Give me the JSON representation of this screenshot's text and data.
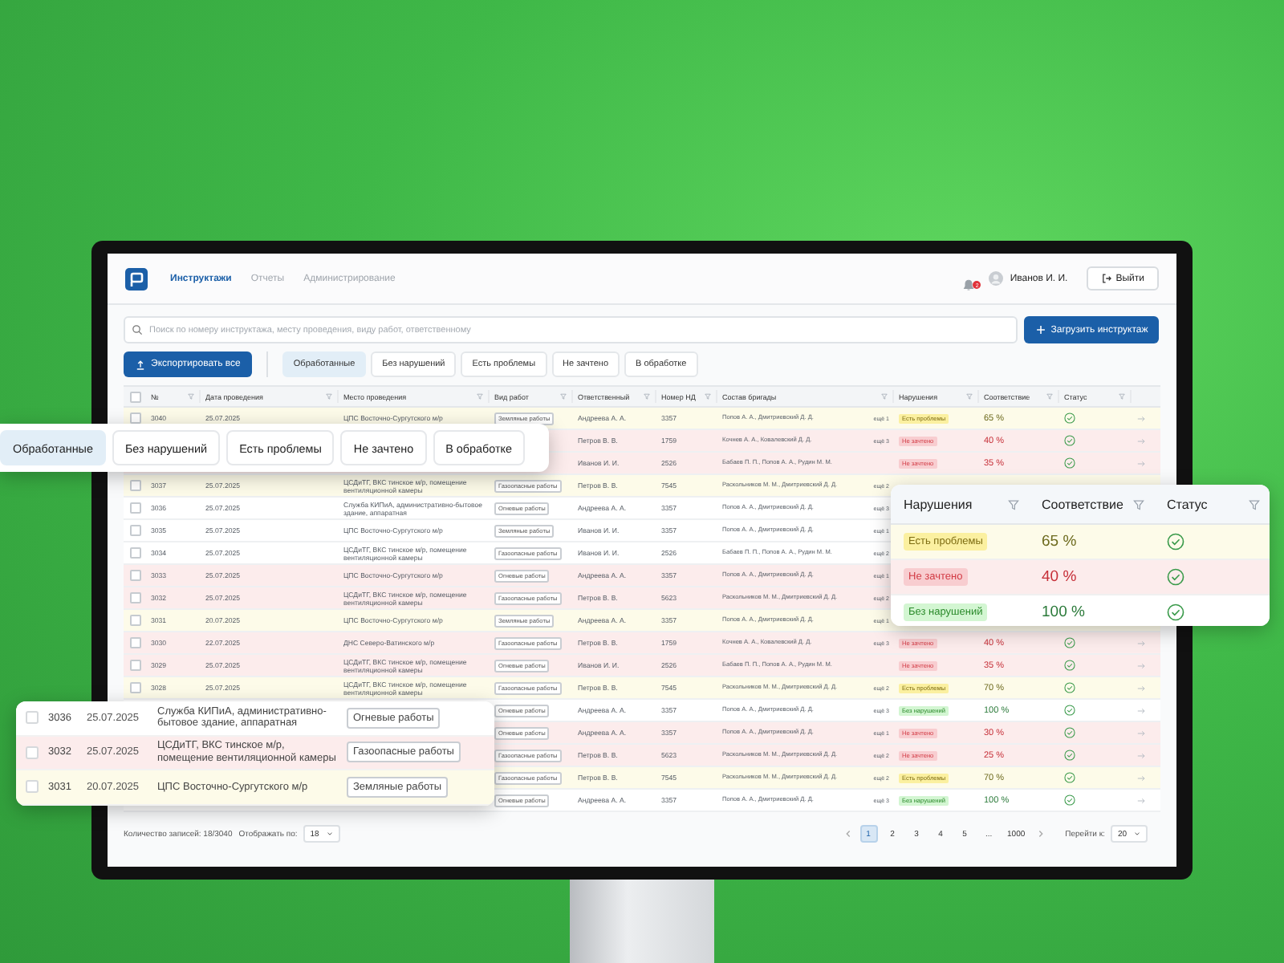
{
  "header": {
    "nav": [
      {
        "label": "Инструктажи",
        "selected": true
      },
      {
        "label": "Отчеты",
        "selected": false
      },
      {
        "label": "Администрирование",
        "selected": false
      }
    ],
    "notifications": "2",
    "user": "Иванов И. И.",
    "logout": "Выйти"
  },
  "search": {
    "placeholder": "Поиск по номеру инструктажа, месту проведения, виду работ, ответственному"
  },
  "upload_button": "Загрузить инструктаж",
  "export_button": "Экспортировать все",
  "filters": [
    {
      "label": "Обработанные",
      "selected": true
    },
    {
      "label": "Без нарушений",
      "selected": false
    },
    {
      "label": "Есть проблемы",
      "selected": false
    },
    {
      "label": "Не зачтено",
      "selected": false
    },
    {
      "label": "В обработке",
      "selected": false
    }
  ],
  "table": {
    "select_all_checked": false,
    "columns": [
      "№",
      "Дата проведения",
      "Место проведения",
      "Вид работ",
      "Ответственный",
      "Номер НД",
      "Состав бригады",
      "Нарушения",
      "Соответствие",
      "Статус"
    ],
    "rows": [
      {
        "kind": "problems",
        "checked": false,
        "number": "3040",
        "date": "25.07.2025",
        "place": "ЦПС Восточно-Сургутского м/р",
        "work": "Земляные работы",
        "responsible": "Андреева А. А.",
        "nd": "3357",
        "brigade": "Попов А. А., Дмитриевский Д. Д.",
        "more": "ещё 1",
        "violation": "Есть проблемы",
        "compliance": "65 %",
        "approved": true
      },
      {
        "kind": "failed",
        "responsible": "Петров В. В.",
        "nd": "1759",
        "brigade": "Кочнев А. А., Ковалевский Д. Д.",
        "more": "ещё 3",
        "violation": "Не зачтено",
        "compliance": "40 %",
        "approved": true
      },
      {
        "kind": "failed",
        "responsible": "Иванов И. И.",
        "nd": "2526",
        "brigade": "Бабаев П. П., Попов А. А., Рудин М. М.",
        "violation": "Не зачтено",
        "compliance": "35 %",
        "approved": true
      },
      {
        "kind": "problems",
        "checked": false,
        "number": "3037",
        "date": "25.07.2025",
        "place": "ЦСДиТГ, ВКС тинское м/р, помещение вентиляционной камеры",
        "work": "Газоопасные работы",
        "responsible": "Петров В. В.",
        "nd": "7545",
        "brigade": "Раскольников М. М., Дмитриевский Д. Д.",
        "more": "ещё 2"
      },
      {
        "kind": "clean",
        "checked": false,
        "number": "3036",
        "date": "25.07.2025",
        "place": "Служба КИПиА, административно-бытовое здание, аппаратная",
        "work": "Огневые работы",
        "responsible": "Андреева А. А.",
        "nd": "3357",
        "brigade": "Попов А. А., Дмитриевский Д. Д.",
        "more": "ещё 3"
      },
      {
        "kind": "clean",
        "checked": false,
        "number": "3035",
        "date": "25.07.2025",
        "place": "ЦПС Восточно-Сургутского м/р",
        "work": "Земляные работы",
        "responsible": "Иванов И. И.",
        "nd": "3357",
        "brigade": "Попов А. А., Дмитриевский Д. Д.",
        "more": "ещё 1"
      },
      {
        "kind": "clean",
        "checked": false,
        "number": "3034",
        "date": "25.07.2025",
        "place": "ЦСДиТГ, ВКС тинское м/р, помещение вентиляционной камеры",
        "work": "Газоопасные работы",
        "responsible": "Иванов И. И.",
        "nd": "2526",
        "brigade": "Бабаев П. П., Попов А. А., Рудин М. М.",
        "more": "ещё 2"
      },
      {
        "kind": "failed",
        "checked": false,
        "number": "3033",
        "date": "25.07.2025",
        "place": "ЦПС Восточно-Сургутского м/р",
        "work": "Огневые работы",
        "responsible": "Андреева А. А.",
        "nd": "3357",
        "brigade": "Попов А. А., Дмитриевский Д. Д.",
        "more": "ещё 1"
      },
      {
        "kind": "failed",
        "checked": false,
        "number": "3032",
        "date": "25.07.2025",
        "place": "ЦСДиТГ, ВКС тинское м/р, помещение вентиляционной камеры",
        "work": "Газоопасные работы",
        "responsible": "Петров В. В.",
        "nd": "5623",
        "brigade": "Раскольников М. М., Дмитриевский Д. Д.",
        "more": "ещё 2"
      },
      {
        "kind": "problems",
        "checked": false,
        "number": "3031",
        "date": "20.07.2025",
        "place": "ЦПС Восточно-Сургутского м/р",
        "work": "Земляные работы",
        "responsible": "Андреева А. А.",
        "nd": "3357",
        "brigade": "Попов А. А., Дмитриевский Д. Д.",
        "more": "ещё 1"
      },
      {
        "kind": "failed",
        "checked": false,
        "number": "3030",
        "date": "22.07.2025",
        "place": "ДНС Северо-Ватинского м/р",
        "work": "Газоопасные работы",
        "responsible": "Петров В. В.",
        "nd": "1759",
        "brigade": "Кочнев А. А., Ковалевский Д. Д.",
        "more": "ещё 3",
        "violation": "Не зачтено",
        "compliance": "40 %",
        "approved": true
      },
      {
        "kind": "failed",
        "checked": false,
        "number": "3029",
        "date": "25.07.2025",
        "place": "ЦСДиТГ, ВКС тинское м/р, помещение вентиляционной камеры",
        "work": "Огневые работы",
        "responsible": "Иванов И. И.",
        "nd": "2526",
        "brigade": "Бабаев П. П., Попов А. А., Рудин М. М.",
        "violation": "Не зачтено",
        "compliance": "35 %",
        "approved": true
      },
      {
        "kind": "problems",
        "checked": false,
        "number": "3028",
        "date": "25.07.2025",
        "place": "ЦСДиТГ, ВКС тинское м/р, помещение вентиляционной камеры",
        "work": "Газоопасные работы",
        "responsible": "Петров В. В.",
        "nd": "7545",
        "brigade": "Раскольников М. М., Дмитриевский Д. Д.",
        "more": "ещё 2",
        "violation": "Есть проблемы",
        "compliance": "70 %",
        "approved": true
      },
      {
        "kind": "clean",
        "work": "Огневые работы",
        "responsible": "Андреева А. А.",
        "nd": "3357",
        "brigade": "Попов А. А., Дмитриевский Д. Д.",
        "more": "ещё 3",
        "violation": "Без нарушений",
        "compliance": "100 %",
        "approved": true
      },
      {
        "kind": "failed",
        "work": "Огневые работы",
        "responsible": "Андреева А. А.",
        "nd": "3357",
        "brigade": "Попов А. А., Дмитриевский Д. Д.",
        "more": "ещё 1",
        "violation": "Не зачтено",
        "compliance": "30 %",
        "approved": true
      },
      {
        "kind": "failed",
        "work": "Газоопасные работы",
        "responsible": "Петров В. В.",
        "nd": "5623",
        "brigade": "Раскольников М. М., Дмитриевский Д. Д.",
        "more": "ещё 2",
        "violation": "Не зачтено",
        "compliance": "25 %",
        "approved": true
      },
      {
        "kind": "problems",
        "work": "Газоопасные работы",
        "responsible": "Петров В. В.",
        "nd": "7545",
        "brigade": "Раскольников М. М., Дмитриевский Д. Д.",
        "more": "ещё 2",
        "violation": "Есть проблемы",
        "compliance": "70 %",
        "approved": true
      },
      {
        "kind": "clean",
        "work": "Огневые работы",
        "responsible": "Андреева А. А.",
        "nd": "3357",
        "brigade": "Попов А. А., Дмитриевский Д. Д.",
        "more": "ещё 3",
        "violation": "Без нарушений",
        "compliance": "100 %",
        "approved": true
      }
    ]
  },
  "footer": {
    "count": "Количество записей: 18/3040",
    "per_page_label": "Отображать по:",
    "per_page": "18",
    "pages": [
      {
        "label": "1",
        "selected": true
      },
      {
        "label": "2",
        "selected": false
      },
      {
        "label": "3",
        "selected": false
      },
      {
        "label": "4",
        "selected": false
      },
      {
        "label": "5",
        "selected": false
      },
      {
        "label": "...",
        "selected": false
      },
      {
        "label": "1000",
        "selected": false
      }
    ],
    "goto_label": "Перейти к:",
    "goto": "20"
  },
  "callouts": {
    "filters": [
      {
        "label": "Обработанные",
        "selected": true
      },
      {
        "label": "Без нарушений",
        "selected": false
      },
      {
        "label": "Есть проблемы",
        "selected": false
      },
      {
        "label": "Не зачтено",
        "selected": false
      },
      {
        "label": "В обработке",
        "selected": false
      }
    ],
    "compliance": {
      "columns": [
        "Нарушения",
        "Соответствие",
        "Статус"
      ],
      "rows": [
        {
          "kind": "problems",
          "violation": "Есть проблемы",
          "compliance": "65 %",
          "approved": true
        },
        {
          "kind": "failed",
          "violation": "Не зачтено",
          "compliance": "40 %",
          "approved": true
        },
        {
          "kind": "clean",
          "violation": "Без нарушений",
          "compliance": "100 %",
          "approved": true
        }
      ]
    },
    "rows": [
      {
        "kind": "clean",
        "checked": false,
        "number": "3036",
        "date": "25.07.2025",
        "place": "Служба КИПиА, административно-бытовое здание, аппаратная",
        "work": "Огневые работы"
      },
      {
        "kind": "failed",
        "checked": false,
        "number": "3032",
        "date": "25.07.2025",
        "place": "ЦСДиТГ, ВКС тинское м/р, помещение вентиляционной камеры",
        "work": "Газоопасные работы"
      },
      {
        "kind": "problems",
        "checked": false,
        "number": "3031",
        "date": "20.07.2025",
        "place": "ЦПС Восточно-Сургутского м/р",
        "work": "Земляные работы"
      }
    ]
  }
}
